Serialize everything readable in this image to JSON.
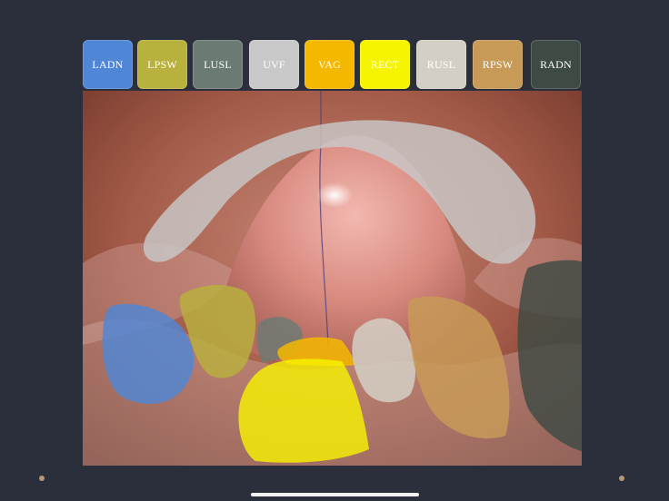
{
  "toolbar": {
    "buttons": [
      {
        "label": "LADN",
        "color": "#4f86d6"
      },
      {
        "label": "LPSW",
        "color": "#b8b13d"
      },
      {
        "label": "LUSL",
        "color": "#6b7b74"
      },
      {
        "label": "UVF",
        "color": "#c8c8c8"
      },
      {
        "label": "VAG",
        "color": "#f5b800"
      },
      {
        "label": "RECT",
        "color": "#f7f400"
      },
      {
        "label": "RUSL",
        "color": "#d4cfc4"
      },
      {
        "label": "RPSW",
        "color": "#c89a58"
      },
      {
        "label": "RADN",
        "color": "#3e4a44"
      }
    ]
  },
  "image": {
    "description_icon": "laparoscopic-pelvis-image"
  }
}
